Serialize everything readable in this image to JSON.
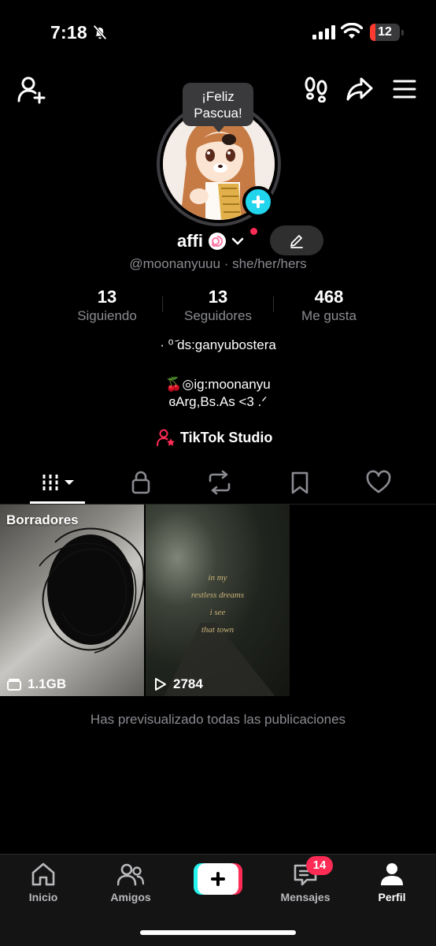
{
  "status_bar": {
    "time": "7:18",
    "battery": "12",
    "battery_fraction": 0.12
  },
  "avatar_bubble": {
    "line1": "¡Feliz",
    "line2": "Pascua!"
  },
  "profile": {
    "display_name": "affi",
    "handle": "@moonanyuuu",
    "pronouns_separator": "·",
    "pronouns": "she/her/hers"
  },
  "stats": [
    {
      "value": "13",
      "label": "Siguiendo"
    },
    {
      "value": "13",
      "label": "Seguidores"
    },
    {
      "value": "468",
      "label": "Me gusta"
    }
  ],
  "bio": {
    "line1": "· ⁰ ᷄ds:ganyubostera",
    "line2": "🍒◎ig:moonanyu",
    "line3": "ɞArg,Bs.As <3 .ᐟ"
  },
  "studio_label": "TikTok Studio",
  "tabs": [
    "videos-icon",
    "lock-icon",
    "repost-icon",
    "bookmark-icon",
    "heart-icon"
  ],
  "posts": [
    {
      "label": "Borradores",
      "meta_icon": "folder-icon",
      "meta": "1.1GB"
    },
    {
      "meta_icon": "play-icon",
      "meta": "2784",
      "overlay_lines": [
        "in my",
        "restless dreams",
        "i see",
        "that town"
      ]
    }
  ],
  "footer_text": "Has previsualizado todas las publicaciones",
  "bottom_nav": {
    "home": "Inicio",
    "friends": "Amigos",
    "inbox": "Mensajes",
    "inbox_badge": "14",
    "profile": "Perfil"
  },
  "colors": {
    "accent_red": "#fe2c55",
    "accent_cyan": "#25f4ee",
    "avatar_add": "#20d5ec",
    "muted_text": "#8a8b91"
  }
}
